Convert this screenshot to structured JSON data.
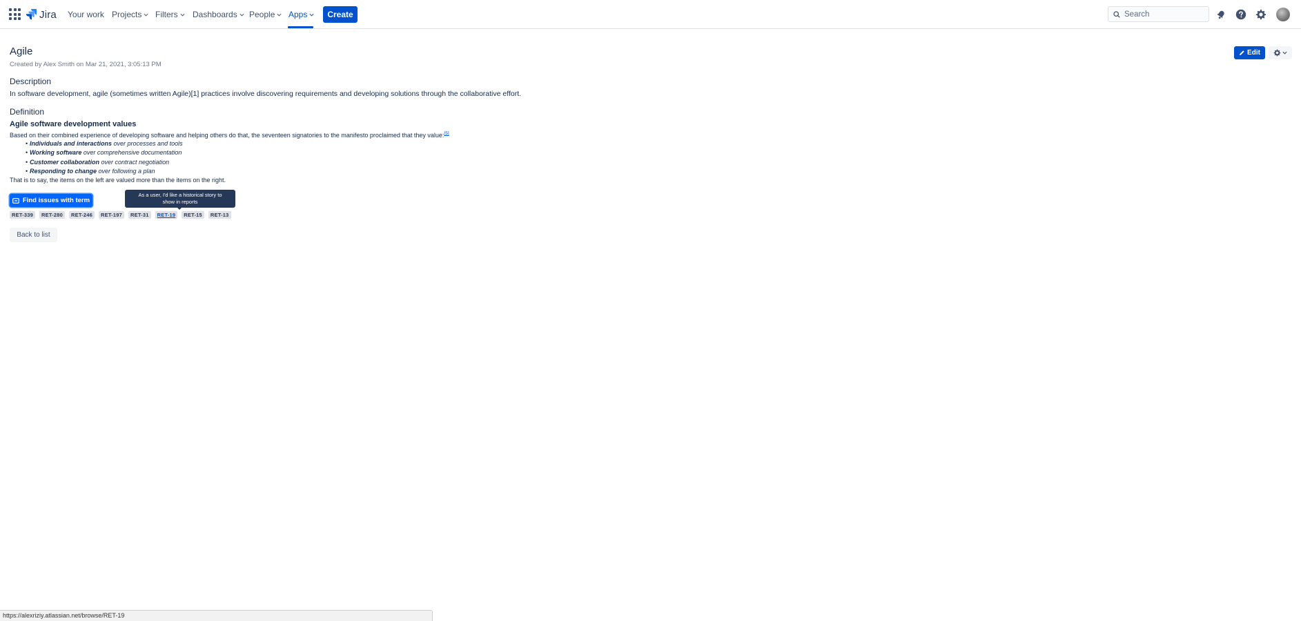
{
  "nav": {
    "logo_text": "Jira",
    "items": [
      {
        "label": "Your work"
      },
      {
        "label": "Projects"
      },
      {
        "label": "Filters"
      },
      {
        "label": "Dashboards"
      },
      {
        "label": "People"
      },
      {
        "label": "Apps"
      }
    ],
    "active_item": "Apps",
    "create_label": "Create",
    "search_placeholder": "Search",
    "icons": [
      "app-switcher-icon",
      "jira-logo-icon",
      "chevron-down-icon",
      "search-icon",
      "notifications-bell-icon",
      "help-icon",
      "settings-gear-icon",
      "user-avatar"
    ]
  },
  "page": {
    "title": "Agile",
    "meta": "Created by Alex Smith on Mar 21, 2021, 3:05:13 PM",
    "edit_label": "Edit",
    "description_heading": "Description",
    "description_text": "In software development, agile (sometimes written Agile)[1] practices involve discovering requirements and developing solutions through the collaborative effort.",
    "definition_heading": "Definition",
    "definition": {
      "subheading": "Agile software development values",
      "intro": "Based on their combined experience of developing software and helping others do that, the seventeen signatories to the manifesto proclaimed that they value:",
      "intro_ref": "[5]",
      "values": [
        {
          "bold": "Individuals and interactions",
          "rest": " over processes and tools"
        },
        {
          "bold": "Working software",
          "rest": " over comprehensive documentation"
        },
        {
          "bold": "Customer collaboration",
          "rest": " over contract negotiation"
        },
        {
          "bold": "Responding to change",
          "rest": " over following a plan"
        }
      ],
      "outro": "That is to say, the items on the left are valued more than the items on the right."
    },
    "find_issues_label": "Find issues with term",
    "tooltip": "As a user, I'd like a historical story to show in reports",
    "issue_tags": [
      "RET-339",
      "RET-280",
      "RET-246",
      "RET-197",
      "RET-31",
      "RET-19",
      "RET-15",
      "RET-13"
    ],
    "hovered_tag": "RET-19",
    "back_label": "Back to list"
  },
  "status_bar": {
    "url": "https://alexriziy.atlassian.net/browse/RET-19"
  },
  "colors": {
    "brand_blue": "#0052cc",
    "focus_blue": "#0065ff",
    "text_dark": "#172b4d",
    "tooltip_bg": "#253858"
  }
}
